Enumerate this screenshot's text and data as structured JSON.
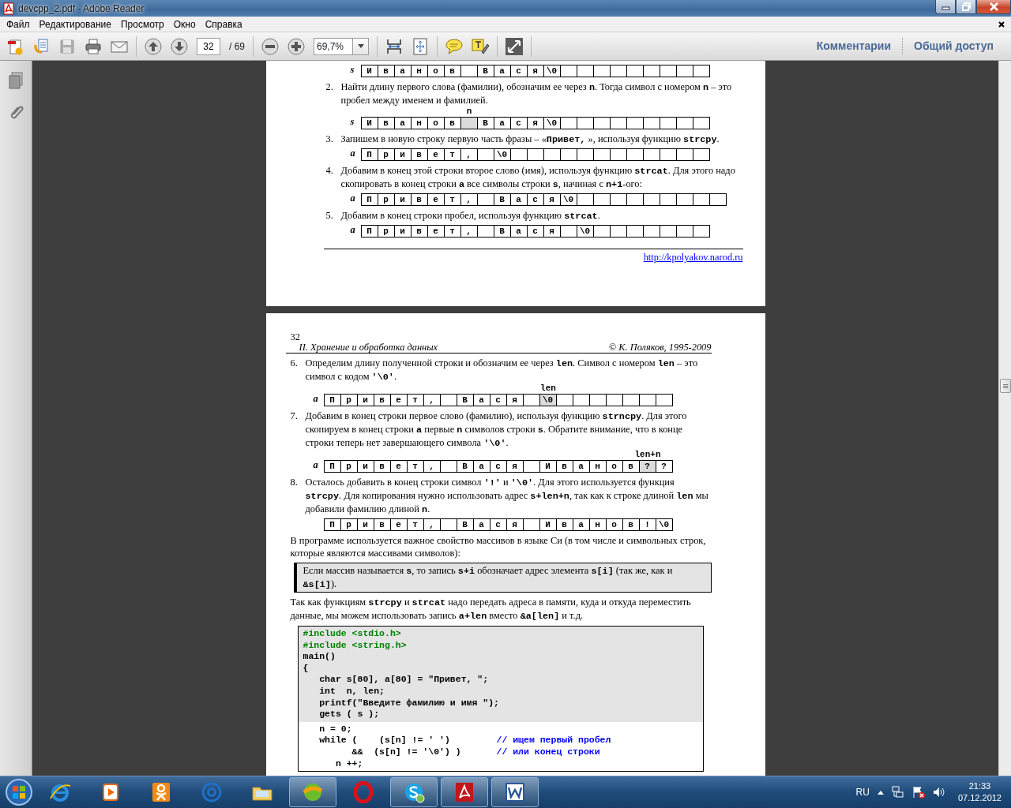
{
  "window": {
    "title": "devcpp_2.pdf - Adobe Reader"
  },
  "menu": [
    "Файл",
    "Редактирование",
    "Просмотр",
    "Окно",
    "Справка"
  ],
  "toolbar": {
    "groups": [
      [
        {
          "kind": "create",
          "disabled": false
        },
        {
          "kind": "combine",
          "disabled": false
        },
        {
          "kind": "save",
          "disabled": true
        },
        {
          "kind": "print",
          "disabled": false
        },
        {
          "kind": "email",
          "disabled": false
        }
      ],
      [
        {
          "kind": "prev",
          "disabled": false
        },
        {
          "kind": "next",
          "disabled": false
        },
        {
          "kind": "page-field",
          "disabled": false,
          "value": "32",
          "total": "/ 69"
        }
      ],
      [
        {
          "kind": "zoom-out",
          "disabled": false
        },
        {
          "kind": "zoom-in",
          "disabled": false
        },
        {
          "kind": "zoom-field",
          "disabled": false,
          "value": "69,7%"
        }
      ],
      [
        {
          "kind": "scroll-mode",
          "disabled": false
        },
        {
          "kind": "fit-page",
          "disabled": false
        }
      ],
      [
        {
          "kind": "comment",
          "disabled": false
        },
        {
          "kind": "highlight",
          "disabled": false
        }
      ],
      [
        {
          "kind": "full-screen",
          "disabled": false
        }
      ]
    ],
    "panels": [
      "Комментарии",
      "Общий доступ"
    ]
  },
  "pages": [
    {
      "blocks": [
        {
          "kind": "grid",
          "label": "s",
          "cells": [
            {
              "text": "И",
              "shaded": false
            },
            {
              "text": "в",
              "shaded": false
            },
            {
              "text": "а",
              "shaded": false
            },
            {
              "text": "н",
              "shaded": false
            },
            {
              "text": "о",
              "shaded": false
            },
            {
              "text": "в",
              "shaded": false
            },
            {
              "shaded": false
            },
            {
              "text": "В",
              "shaded": false
            },
            {
              "text": "а",
              "shaded": false
            },
            {
              "text": "с",
              "shaded": false
            },
            {
              "text": "я",
              "shaded": false
            },
            {
              "text": "\\0",
              "shaded": false
            },
            {
              "shaded": false
            },
            {
              "shaded": false
            },
            {
              "shaded": false
            },
            {
              "shaded": false
            },
            {
              "shaded": false
            },
            {
              "shaded": false
            },
            {
              "shaded": false
            },
            {
              "shaded": false
            },
            {
              "shaded": false
            }
          ]
        },
        {
          "kind": "item",
          "number": "2.",
          "text": "Найти длину первого слова (фамилии), обозначим ее через **n**. Тогда символ с номером **n** – это пробел между именем и фамилией."
        },
        {
          "kind": "grid",
          "label": "s",
          "cells": [
            {
              "text": "И",
              "shaded": false
            },
            {
              "text": "в",
              "shaded": false
            },
            {
              "text": "а",
              "shaded": false
            },
            {
              "text": "н",
              "shaded": false
            },
            {
              "text": "о",
              "shaded": false
            },
            {
              "text": "в",
              "shaded": false
            },
            {
              "shaded": true,
              "pointer": "n"
            },
            {
              "text": "В",
              "shaded": false
            },
            {
              "text": "а",
              "shaded": false
            },
            {
              "text": "с",
              "shaded": false
            },
            {
              "text": "я",
              "shaded": false
            },
            {
              "text": "\\0",
              "shaded": false
            },
            {
              "shaded": false
            },
            {
              "shaded": false
            },
            {
              "shaded": false
            },
            {
              "shaded": false
            },
            {
              "shaded": false
            },
            {
              "shaded": false
            },
            {
              "shaded": false
            },
            {
              "shaded": false
            },
            {
              "shaded": false
            }
          ]
        },
        {
          "kind": "item",
          "number": "3.",
          "text": "Запишем в новую строку первую часть фразы – «**Привет,**  », используя функцию **strcpy**."
        },
        {
          "kind": "grid",
          "label": "a",
          "cells": [
            {
              "text": "П",
              "shaded": false
            },
            {
              "text": "р",
              "shaded": false
            },
            {
              "text": "и",
              "shaded": false
            },
            {
              "text": "в",
              "shaded": false
            },
            {
              "text": "е",
              "shaded": false
            },
            {
              "text": "т",
              "shaded": false
            },
            {
              "text": ",",
              "shaded": false
            },
            {
              "shaded": false
            },
            {
              "text": "\\0",
              "shaded": false
            },
            {
              "shaded": false
            },
            {
              "shaded": false
            },
            {
              "shaded": false
            },
            {
              "shaded": false
            },
            {
              "shaded": false
            },
            {
              "shaded": false
            },
            {
              "shaded": false
            },
            {
              "shaded": false
            },
            {
              "shaded": false
            },
            {
              "shaded": false
            },
            {
              "shaded": false
            },
            {
              "shaded": false
            }
          ]
        },
        {
          "kind": "item",
          "number": "4.",
          "text": "Добавим в конец этой строки второе слово (имя), используя функцию **strcat**. Для этого надо скопировать в конец строки **a** все символы строки **s**, начиная с **n+1**-ого:"
        },
        {
          "kind": "grid",
          "label": "a",
          "cells": [
            {
              "text": "П",
              "shaded": false
            },
            {
              "text": "р",
              "shaded": false
            },
            {
              "text": "и",
              "shaded": false
            },
            {
              "text": "в",
              "shaded": false
            },
            {
              "text": "е",
              "shaded": false
            },
            {
              "text": "т",
              "shaded": false
            },
            {
              "text": ",",
              "shaded": false
            },
            {
              "shaded": false
            },
            {
              "text": "В",
              "shaded": false
            },
            {
              "text": "а",
              "shaded": false
            },
            {
              "text": "с",
              "shaded": false
            },
            {
              "text": "я",
              "shaded": false
            },
            {
              "text": "\\0",
              "shaded": false
            },
            {
              "shaded": false
            },
            {
              "shaded": false
            },
            {
              "shaded": false
            },
            {
              "shaded": false
            },
            {
              "shaded": false
            },
            {
              "shaded": false
            },
            {
              "shaded": false
            },
            {
              "shaded": false
            },
            {
              "shaded": false
            }
          ]
        },
        {
          "kind": "item",
          "number": "5.",
          "text": "Добавим в конец строки пробел, используя функцию **strcat**."
        },
        {
          "kind": "grid",
          "label": "a",
          "cells": [
            {
              "text": "П",
              "shaded": false
            },
            {
              "text": "р",
              "shaded": false
            },
            {
              "text": "и",
              "shaded": false
            },
            {
              "text": "в",
              "shaded": false
            },
            {
              "text": "е",
              "shaded": false
            },
            {
              "text": "т",
              "shaded": false
            },
            {
              "text": ",",
              "shaded": false
            },
            {
              "shaded": false
            },
            {
              "text": "В",
              "shaded": false
            },
            {
              "text": "а",
              "shaded": false
            },
            {
              "text": "с",
              "shaded": false
            },
            {
              "text": "я",
              "shaded": false
            },
            {
              "shaded": false
            },
            {
              "text": "\\0",
              "shaded": false
            },
            {
              "shaded": false
            },
            {
              "shaded": false
            },
            {
              "shaded": false
            },
            {
              "shaded": false
            },
            {
              "shaded": false
            },
            {
              "shaded": false
            },
            {
              "shaded": false
            }
          ]
        },
        {
          "kind": "rule"
        },
        {
          "kind": "link",
          "text": "http://kpolyakov.narod.ru"
        }
      ]
    },
    {
      "blocks": [
        {
          "kind": "header",
          "number": "32",
          "left": "II. Хранение и обработка данных",
          "right": "© К. Поляков, 1995-2009"
        },
        {
          "kind": "item",
          "number": "6.",
          "text": "Определим длину полученной строки и обозначим ее через **len**. Символ с номером **len** – это символ с кодом **'\\0'**."
        },
        {
          "kind": "grid",
          "label": "a",
          "cells": [
            {
              "text": "П",
              "shaded": false
            },
            {
              "text": "р",
              "shaded": false
            },
            {
              "text": "и",
              "shaded": false
            },
            {
              "text": "в",
              "shaded": false
            },
            {
              "text": "е",
              "shaded": false
            },
            {
              "text": "т",
              "shaded": false
            },
            {
              "text": ",",
              "shaded": false
            },
            {
              "shaded": false
            },
            {
              "text": "В",
              "shaded": false
            },
            {
              "text": "а",
              "shaded": false
            },
            {
              "text": "с",
              "shaded": false
            },
            {
              "text": "я",
              "shaded": false
            },
            {
              "shaded": false
            },
            {
              "text": "\\0",
              "shaded": true,
              "pointer": "len"
            },
            {
              "shaded": false
            },
            {
              "shaded": false
            },
            {
              "shaded": false
            },
            {
              "shaded": false
            },
            {
              "shaded": false
            },
            {
              "shaded": false
            },
            {
              "shaded": false
            }
          ]
        },
        {
          "kind": "item",
          "number": "7.",
          "text": "Добавим в конец строки первое слово (фамилию), используя функцию **strncpy**. Для этого скопируем в конец строки **a** первые **n** символов строки **s**. Обратите внимание, что в конце строки теперь нет завершающего символа **'\\0'**."
        },
        {
          "kind": "grid",
          "label": "a",
          "cells": [
            {
              "text": "П",
              "shaded": false
            },
            {
              "text": "р",
              "shaded": false
            },
            {
              "text": "и",
              "shaded": false
            },
            {
              "text": "в",
              "shaded": false
            },
            {
              "text": "е",
              "shaded": false
            },
            {
              "text": "т",
              "shaded": false
            },
            {
              "text": ",",
              "shaded": false
            },
            {
              "shaded": false
            },
            {
              "text": "В",
              "shaded": false
            },
            {
              "text": "а",
              "shaded": false
            },
            {
              "text": "с",
              "shaded": false
            },
            {
              "text": "я",
              "shaded": false
            },
            {
              "shaded": false
            },
            {
              "text": "И",
              "shaded": false
            },
            {
              "text": "в",
              "shaded": false
            },
            {
              "text": "а",
              "shaded": false
            },
            {
              "text": "н",
              "shaded": false
            },
            {
              "text": "о",
              "shaded": false
            },
            {
              "text": "в",
              "shaded": false
            },
            {
              "text": "?",
              "shaded": true,
              "pointer": "len+n"
            },
            {
              "text": "?",
              "shaded": false
            }
          ]
        },
        {
          "kind": "item",
          "number": "8.",
          "text": "Осталось добавить в конец строки символ **'!'** и **'\\0'**. Для этого используется функция **strcpy**. Для копирования нужно использовать адрес **s+len+n**, так как к строке длиной **len** мы добавили фамилию длиной **n**."
        },
        {
          "kind": "grid",
          "cells": [
            {
              "text": "П",
              "shaded": false
            },
            {
              "text": "р",
              "shaded": false
            },
            {
              "text": "и",
              "shaded": false
            },
            {
              "text": "в",
              "shaded": false
            },
            {
              "text": "е",
              "shaded": false
            },
            {
              "text": "т",
              "shaded": false
            },
            {
              "text": ",",
              "shaded": false
            },
            {
              "shaded": false
            },
            {
              "text": "В",
              "shaded": false
            },
            {
              "text": "а",
              "shaded": false
            },
            {
              "text": "с",
              "shaded": false
            },
            {
              "text": "я",
              "shaded": false
            },
            {
              "shaded": false
            },
            {
              "text": "И",
              "shaded": false
            },
            {
              "text": "в",
              "shaded": false
            },
            {
              "text": "а",
              "shaded": false
            },
            {
              "text": "н",
              "shaded": false
            },
            {
              "text": "о",
              "shaded": false
            },
            {
              "text": "в",
              "shaded": false
            },
            {
              "text": "!",
              "shaded": false
            },
            {
              "text": "\\0",
              "shaded": false
            }
          ]
        },
        {
          "kind": "paragraph",
          "text": "В программе используется важное свойство массивов в языке Си (в том числе и символьных строк, которые являются массивами символов):"
        },
        {
          "kind": "note",
          "text": "Если массив называется **s**, то запись **s+i** обозначает адрес элемента **s[i]** (так же, как и **&s[i]**)."
        },
        {
          "kind": "paragraph",
          "text": "Так как функциям **strcpy** и **strcat** надо передать адреса в памяти, куда и откуда переместить данные,  мы можем использовать запись **a+len** вместо **&a[len]** и т.д."
        },
        {
          "kind": "code",
          "sections": [
            {
              "shaded": true,
              "lines": [
                {
                  "kind": "directive",
                  "text": "#include <stdio.h>"
                },
                {
                  "kind": "directive",
                  "text": "#include <string.h>"
                },
                {
                  "kind": "code",
                  "text": "main()"
                },
                {
                  "kind": "code",
                  "text": "{"
                },
                {
                  "kind": "code",
                  "text": "   char s[80], a[80] = \"Привет, \";"
                },
                {
                  "kind": "code",
                  "text": "   int  n, len;"
                },
                {
                  "kind": "code",
                  "text": "   printf(\"Введите фамилию и имя \");"
                },
                {
                  "kind": "code",
                  "text": "   gets ( s );"
                }
              ]
            },
            {
              "shaded": false,
              "lines": [
                {
                  "kind": "code",
                  "text": "   n = 0;"
                },
                {
                  "kind": "code",
                  "text": "   while (    (s[n] != ' ')",
                  "comment": "// ищем первый пробел"
                },
                {
                  "kind": "code",
                  "text": "         &&  (s[n] != '\\0') )",
                  "comment": "// или конец строки"
                },
                {
                  "kind": "code",
                  "text": "      n ++;"
                }
              ]
            }
          ]
        }
      ]
    }
  ],
  "taskbar": {
    "apps": [
      {
        "kind": "ie",
        "running": false
      },
      {
        "kind": "media",
        "running": false
      },
      {
        "kind": "ok",
        "running": false
      },
      {
        "kind": "mail",
        "running": false
      },
      {
        "kind": "files",
        "running": false
      },
      {
        "kind": "green",
        "running": true
      },
      {
        "kind": "opera",
        "running": false
      },
      {
        "kind": "skype",
        "running": true
      },
      {
        "kind": "acrobat",
        "running": true
      },
      {
        "kind": "word",
        "running": true
      }
    ],
    "language": "RU",
    "time": "21:33",
    "date": "07.12.2012"
  }
}
